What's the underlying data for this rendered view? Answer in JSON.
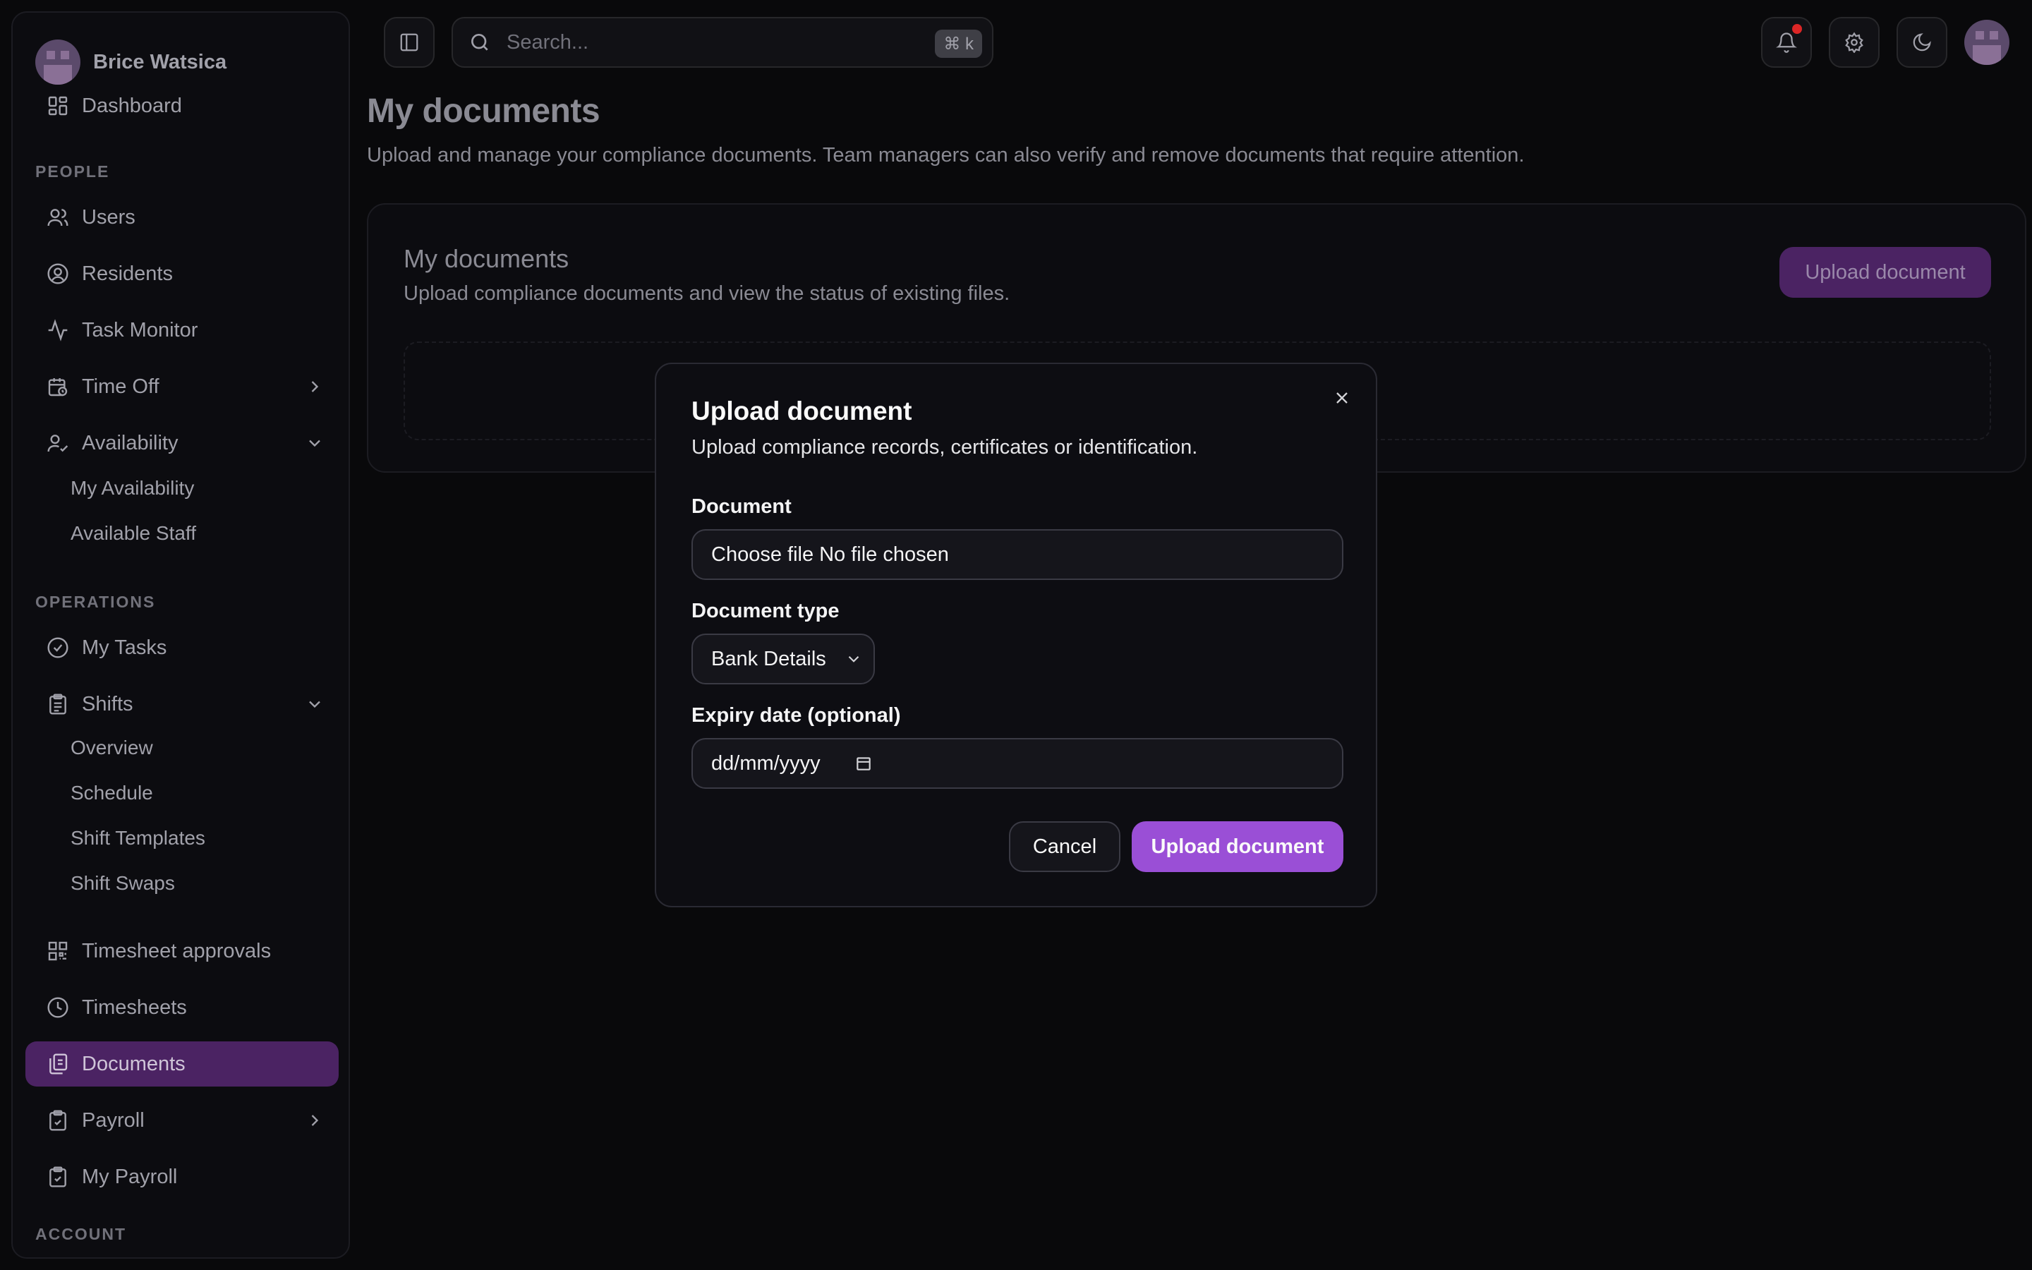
{
  "user": {
    "name": "Brice Watsica"
  },
  "sidebar": {
    "top_items": [
      {
        "label": "Dashboard",
        "icon": "dashboard-icon"
      }
    ],
    "sections": {
      "people": "PEOPLE",
      "operations": "OPERATIONS",
      "account": "ACCOUNT"
    },
    "people_items": [
      {
        "label": "Users",
        "icon": "users-icon"
      },
      {
        "label": "Residents",
        "icon": "user-circle-icon"
      },
      {
        "label": "Task Monitor",
        "icon": "activity-icon"
      },
      {
        "label": "Time Off",
        "icon": "calendar-clock-icon"
      },
      {
        "label": "Availability",
        "icon": "user-check-icon"
      }
    ],
    "availability_sub": [
      "My Availability",
      "Available Staff"
    ],
    "operations_items": [
      {
        "label": "My Tasks",
        "icon": "check-circle-icon"
      },
      {
        "label": "Shifts",
        "icon": "clipboard-list-icon"
      }
    ],
    "shifts_sub": [
      "Overview",
      "Schedule",
      "Shift Templates",
      "Shift Swaps"
    ],
    "more_items": [
      {
        "label": "Timesheet approvals",
        "icon": "qr-code-icon"
      },
      {
        "label": "Timesheets",
        "icon": "clock-icon"
      },
      {
        "label": "Documents",
        "icon": "documents-icon",
        "active": true
      },
      {
        "label": "Payroll",
        "icon": "clipboard-check-icon"
      },
      {
        "label": "My Payroll",
        "icon": "clipboard-check-icon"
      }
    ]
  },
  "topbar": {
    "search_placeholder": "Search...",
    "search_shortcut": "⌘ k"
  },
  "page": {
    "title": "My documents",
    "subtitle": "Upload and manage your compliance documents. Team managers can also verify and remove documents that require attention."
  },
  "card": {
    "title": "My documents",
    "subtitle": "Upload compliance documents and view the status of existing files.",
    "upload_button": "Upload document"
  },
  "modal": {
    "title": "Upload document",
    "subtitle": "Upload compliance records, certificates or identification.",
    "document_label": "Document",
    "file_button": "Choose file",
    "file_status": "No file chosen",
    "type_label": "Document type",
    "type_value": "Bank Details",
    "expiry_label": "Expiry date (optional)",
    "expiry_placeholder": "dd/mm/yyyy",
    "cancel": "Cancel",
    "submit": "Upload document"
  },
  "colors": {
    "accent": "#9a4fd6",
    "active_nav": "#4b2363",
    "notification": "#dc2626"
  }
}
